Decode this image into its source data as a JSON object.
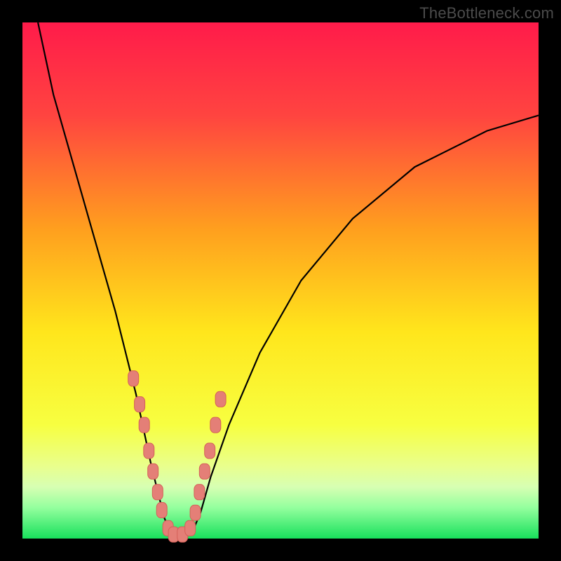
{
  "watermark": "TheBottleneck.com",
  "gradient": {
    "stops": [
      {
        "offset": 0,
        "color": "#ff1b4a"
      },
      {
        "offset": 18,
        "color": "#ff4440"
      },
      {
        "offset": 40,
        "color": "#ff9f1e"
      },
      {
        "offset": 60,
        "color": "#ffe61c"
      },
      {
        "offset": 78,
        "color": "#f7ff41"
      },
      {
        "offset": 86,
        "color": "#e9ff8d"
      },
      {
        "offset": 90,
        "color": "#d7ffb3"
      },
      {
        "offset": 94,
        "color": "#94ff9e"
      },
      {
        "offset": 100,
        "color": "#18e05c"
      }
    ]
  },
  "chart_data": {
    "type": "line",
    "title": "",
    "xlabel": "",
    "ylabel": "",
    "xlim": [
      0,
      100
    ],
    "ylim": [
      0,
      100
    ],
    "notes": "V-shaped bottleneck curve. y = 0 means green (bottom, optimal), y = 100 means top (red). x is a relative position along the horizontal axis.",
    "series": [
      {
        "name": "bottleneck-curve",
        "x": [
          3,
          6,
          10,
          14,
          18,
          20,
          22,
          23.5,
          25,
          26.5,
          27.5,
          28.5,
          29.5,
          31,
          33,
          34.5,
          36.5,
          40,
          46,
          54,
          64,
          76,
          90,
          100
        ],
        "values": [
          100,
          86,
          72,
          58,
          44,
          36,
          28,
          21,
          14,
          8,
          4,
          1.5,
          0.7,
          0.7,
          1.5,
          5,
          12,
          22,
          36,
          50,
          62,
          72,
          79,
          82
        ]
      }
    ],
    "markers": {
      "name": "highlighted-points",
      "x": [
        21.5,
        22.7,
        23.6,
        24.5,
        25.3,
        26.2,
        27.0,
        28.2,
        29.3,
        31.0,
        32.5,
        33.5,
        34.3,
        35.3,
        36.3,
        37.4,
        38.4
      ],
      "values": [
        31,
        26,
        22,
        17,
        13,
        9,
        5.5,
        2,
        0.8,
        0.8,
        2,
        5,
        9,
        13,
        17,
        22,
        27
      ]
    }
  }
}
